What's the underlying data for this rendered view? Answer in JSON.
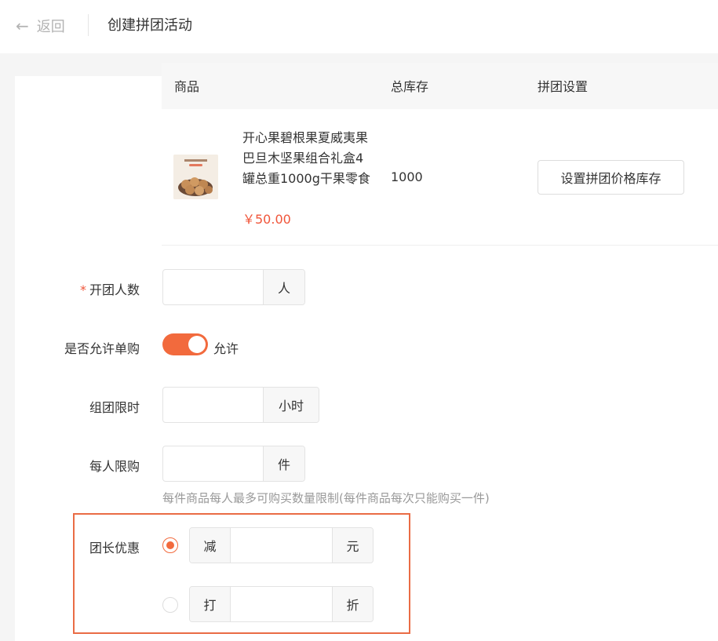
{
  "header": {
    "back_label": "返回",
    "title": "创建拼团活动"
  },
  "table": {
    "columns": [
      "商品",
      "总库存",
      "拼团设置"
    ],
    "rows": [
      {
        "name": "开心果碧根果夏威夷果巴旦木坚果组合礼盒4罐总重1000g干果零食",
        "price": "￥50.00",
        "stock": "1000",
        "action_label": "设置拼团价格库存"
      }
    ]
  },
  "form": {
    "group_size": {
      "label": "开团人数",
      "required_mark": "*",
      "value": "",
      "suffix": "人"
    },
    "single_buy": {
      "label": "是否允许单购",
      "enabled": true,
      "text": "允许"
    },
    "time_limit": {
      "label": "组团限时",
      "value": "",
      "suffix": "小时"
    },
    "per_person": {
      "label": "每人限购",
      "value": "",
      "suffix": "件",
      "hint": "每件商品每人最多可购买数量限制(每件商品每次只能购买一件)"
    },
    "leader_discount": {
      "label": "团长优惠",
      "options": [
        {
          "prefix": "减",
          "value": "",
          "suffix": "元",
          "selected": true
        },
        {
          "prefix": "打",
          "value": "",
          "suffix": "折",
          "selected": false
        }
      ]
    }
  },
  "colors": {
    "accent": "#f26a3d",
    "price": "#f0553a",
    "highlight_border": "#ea6c45"
  }
}
